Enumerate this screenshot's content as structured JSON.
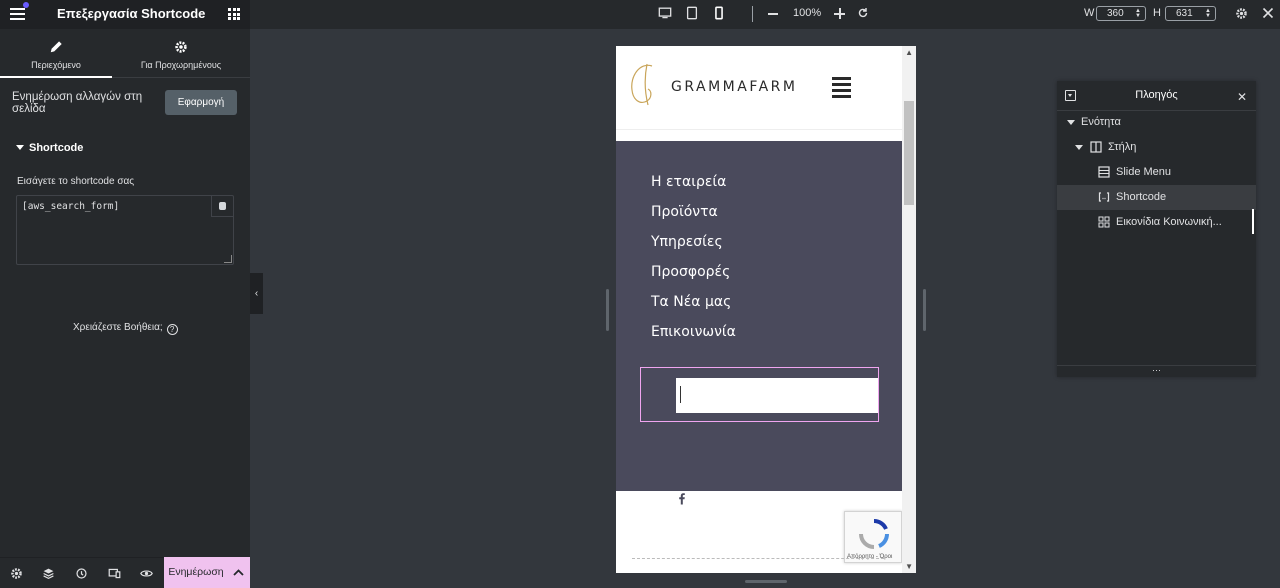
{
  "panel": {
    "title": "Επεξεργασία Shortcode",
    "tabs": [
      {
        "label": "Περιεχόμενο",
        "icon": "pencil-icon",
        "active": true
      },
      {
        "label": "Για Προχωρημένους",
        "icon": "gear-icon",
        "active": false
      }
    ],
    "update_text": "Ενημέρωση αλλαγών στη σελίδα",
    "apply_label": "Εφαρμογή",
    "section_title": "Shortcode",
    "field_label": "Εισάγετε το shortcode σας",
    "field_value": "[aws_search_form]",
    "help_text": "Χρειάζεστε Βοήθεια;",
    "update_button": "Ενημέρωση"
  },
  "toolbar": {
    "zoom": "100%",
    "width_label": "W",
    "width_value": "360",
    "height_label": "H",
    "height_value": "631"
  },
  "preview": {
    "logo_text": "GRAMMAFARM",
    "menu_items": [
      "Η εταιρεία",
      "Προϊόντα",
      "Υπηρεσίες",
      "Προσφορές",
      "Τα Νέα μας",
      "Επικοινωνία"
    ],
    "recaptcha_terms": "Απόρρητο - Όροι"
  },
  "navigator": {
    "title": "Πλοηγός",
    "items": [
      {
        "label": "Ενότητα",
        "icon": "caret-down-icon"
      },
      {
        "label": "Στήλη",
        "icon": "column-icon"
      },
      {
        "label": "Slide Menu",
        "icon": "slide-menu-icon"
      },
      {
        "label": "Shortcode",
        "icon": "shortcode-icon",
        "selected": true
      },
      {
        "label": "Εικονίδια Κοινωνική...",
        "icon": "social-icons-icon"
      }
    ]
  },
  "colors": {
    "panel_bg": "#26292c",
    "canvas_bg": "#33373d",
    "accent_pink": "#f0c2ef",
    "menu_bg": "#4a4a5c",
    "notify_dot": "#6a5cff"
  }
}
